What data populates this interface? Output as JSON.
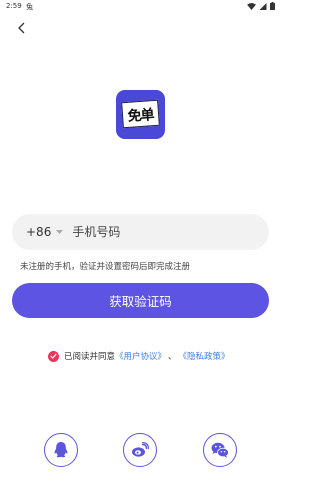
{
  "status_bar": {
    "time": "2:59",
    "app_glyph": "兔"
  },
  "nav": {
    "back_icon": "chevron-left-icon"
  },
  "logo": {
    "text": "免单",
    "colors": {
      "background": "#4a48d6"
    }
  },
  "phone": {
    "country_code": "+86",
    "placeholder": "手机号码",
    "value": ""
  },
  "hint": "未注册的手机，验证并设置密码后即完成注册",
  "submit_label": "获取验证码",
  "agreement": {
    "prefix": "已阅读并同意",
    "user_agreement": "《用户协议》",
    "separator": "、",
    "privacy_policy": "《隐私政策》",
    "checked": true
  },
  "social_login": [
    {
      "icon": "qq-icon"
    },
    {
      "icon": "weibo-icon"
    },
    {
      "icon": "wechat-icon"
    }
  ],
  "colors": {
    "accent": "#5e54e4",
    "check": "#e8365d",
    "link": "#3a7fe0"
  }
}
